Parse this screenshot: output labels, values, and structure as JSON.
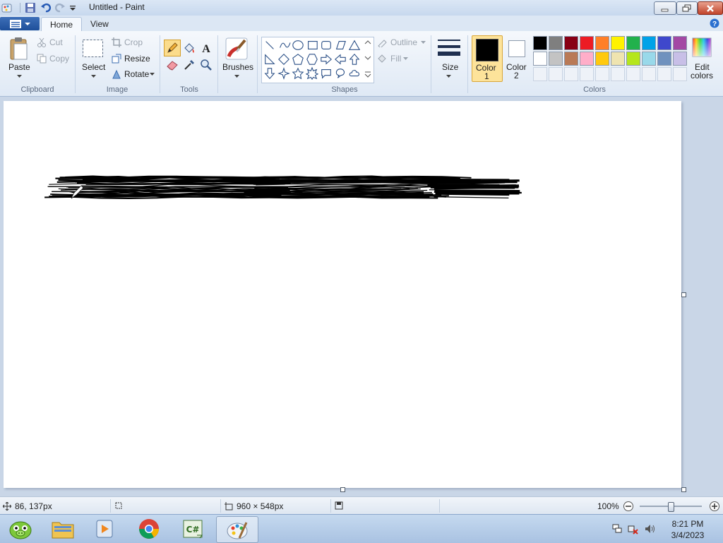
{
  "window": {
    "title": "Untitled - Paint"
  },
  "tabs": {
    "home": "Home",
    "view": "View"
  },
  "clipboard": {
    "paste": "Paste",
    "cut": "Cut",
    "copy": "Copy",
    "label": "Clipboard"
  },
  "image": {
    "select": "Select",
    "crop": "Crop",
    "resize": "Resize",
    "rotate": "Rotate",
    "label": "Image"
  },
  "tools": {
    "label": "Tools",
    "active": "pencil-icon"
  },
  "brushes": {
    "label": "Brushes"
  },
  "shapes": {
    "outline": "Outline",
    "fill": "Fill",
    "label": "Shapes"
  },
  "size": {
    "label": "Size"
  },
  "colors": {
    "color1": "Color",
    "color1_num": "1",
    "color2": "Color",
    "color2_num": "2",
    "edit_colors": "Edit",
    "edit_colors_2": "colors",
    "label": "Colors",
    "color1_value": "#000000",
    "color2_value": "#ffffff",
    "palette_row1": [
      "#000000",
      "#7f7f7f",
      "#880015",
      "#ed1c24",
      "#ff7f27",
      "#fff200",
      "#22b14c",
      "#00a2e8",
      "#3f48cc",
      "#a349a4"
    ],
    "palette_row2": [
      "#ffffff",
      "#c3c3c3",
      "#b97a57",
      "#ffaec9",
      "#ffc90e",
      "#efe4b0",
      "#b5e61d",
      "#99d9ea",
      "#7092be",
      "#c8bfe7"
    ]
  },
  "status": {
    "cursor_pos": "86, 137px",
    "image_size": "960 × 548px",
    "zoom": "100%",
    "zoom_fraction": 0.5
  },
  "taskbar": {
    "apps": [
      "angry-birds-icon",
      "file-explorer-icon",
      "media-player-icon",
      "chrome-icon",
      "csharp-icon",
      "paint-icon"
    ],
    "time": "8:21 PM",
    "date": "3/4/2023"
  }
}
